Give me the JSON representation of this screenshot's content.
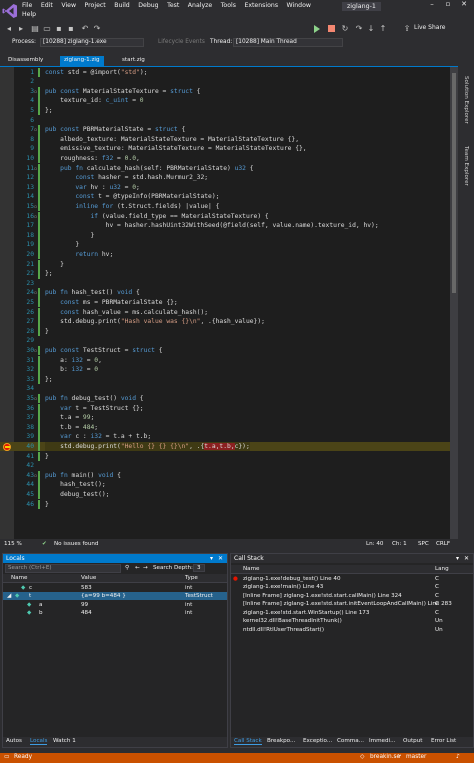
{
  "menu": {
    "items": [
      "File",
      "Edit",
      "View",
      "Project",
      "Build",
      "Debug",
      "Test",
      "Analyze",
      "Tools",
      "Extensions",
      "Window",
      "Help"
    ],
    "project_title": "ziglang-1"
  },
  "toolbar": {
    "live_share": "Live Share"
  },
  "process_bar": {
    "process_label": "Process:",
    "process_value": "[10288] ziglang-1.exe",
    "lifecycle_label": "Lifecycle Events",
    "thread_label": "Thread:",
    "thread_value": "[10288] Main Thread"
  },
  "tabs": {
    "disassembly": "Disassembly",
    "file1": "ziglang-1.zig",
    "file2": "start.zig"
  },
  "editor": {
    "lines": [
      {
        "n": "1",
        "code": "const std = @import(\"std\");"
      },
      {
        "n": "2",
        "code": ""
      },
      {
        "n": "3",
        "code": "pub const MaterialStateTexture = struct {"
      },
      {
        "n": "4",
        "code": "    texture_id: c_uint = 0"
      },
      {
        "n": "5",
        "code": "};"
      },
      {
        "n": "6",
        "code": ""
      },
      {
        "n": "7",
        "code": "pub const PBRMaterialState = struct {"
      },
      {
        "n": "8",
        "code": "    albedo_texture: MaterialStateTexture = MaterialStateTexture {},"
      },
      {
        "n": "9",
        "code": "    emissive_texture: MaterialStateTexture = MaterialStateTexture {},"
      },
      {
        "n": "10",
        "code": "    roughness: f32 = 0.0,"
      },
      {
        "n": "11",
        "code": "    pub fn calculate_hash(self: PBRMaterialState) u32 {"
      },
      {
        "n": "12",
        "code": "        const hasher = std.hash.Murmur2_32;"
      },
      {
        "n": "13",
        "code": "        var hv : u32 = 0;"
      },
      {
        "n": "14",
        "code": "        const t = @typeInfo(PBRMaterialState);"
      },
      {
        "n": "15",
        "code": "        inline for (t.Struct.fields) |value| {"
      },
      {
        "n": "16",
        "code": "            if (value.field_type == MaterialStateTexture) {"
      },
      {
        "n": "17",
        "code": "                hv = hasher.hashUint32WithSeed(@field(self, value.name).texture_id, hv);"
      },
      {
        "n": "18",
        "code": "            }"
      },
      {
        "n": "19",
        "code": "        }"
      },
      {
        "n": "20",
        "code": "        return hv;"
      },
      {
        "n": "21",
        "code": "    }"
      },
      {
        "n": "22",
        "code": "};"
      },
      {
        "n": "23",
        "code": ""
      },
      {
        "n": "24",
        "code": "pub fn hash_test() void {"
      },
      {
        "n": "25",
        "code": "    const ms = PBRMaterialState {};"
      },
      {
        "n": "26",
        "code": "    const hash_value = ms.calculate_hash();"
      },
      {
        "n": "27",
        "code": "    std.debug.print(\"Hash value was {}\\n\", .{hash_value});"
      },
      {
        "n": "28",
        "code": "}"
      },
      {
        "n": "29",
        "code": ""
      },
      {
        "n": "30",
        "code": "pub const TestStruct = struct {"
      },
      {
        "n": "31",
        "code": "    a: i32 = 0,"
      },
      {
        "n": "32",
        "code": "    b: i32 = 0"
      },
      {
        "n": "33",
        "code": "};"
      },
      {
        "n": "34",
        "code": ""
      },
      {
        "n": "35",
        "code": "pub fn debug_test() void {"
      },
      {
        "n": "36",
        "code": "    var t = TestStruct {};"
      },
      {
        "n": "37",
        "code": "    t.a = 99;"
      },
      {
        "n": "38",
        "code": "    t.b = 484;"
      },
      {
        "n": "39",
        "code": "    var c : i32 = t.a + t.b;"
      },
      {
        "n": "40",
        "code": "    std.debug.print(\"Hello {} {} {}\\n\", .{t.a,t.b,c});"
      },
      {
        "n": "41",
        "code": "}"
      },
      {
        "n": "42",
        "code": ""
      },
      {
        "n": "43",
        "code": "pub fn main() void {"
      },
      {
        "n": "44",
        "code": "    hash_test();"
      },
      {
        "n": "45",
        "code": "    debug_test();"
      },
      {
        "n": "46",
        "code": "}"
      }
    ]
  },
  "editor_status": {
    "zoom": "115 %",
    "issues": "No issues found",
    "ln": "Ln: 40",
    "ch": "Ch: 1",
    "spc": "SPC",
    "crlf": "CRLF"
  },
  "side_tabs": {
    "solution_explorer": "Solution Explorer",
    "team_explorer": "Team Explorer"
  },
  "locals": {
    "title": "Locals",
    "search_placeholder": "Search (Ctrl+E)",
    "search_depth_label": "Search Depth:",
    "search_depth_value": "3",
    "columns": [
      "Name",
      "Value",
      "Type"
    ],
    "rows": [
      {
        "name": "c",
        "value": "583",
        "type": "int"
      },
      {
        "name": "t",
        "value": "{a=99 b=484 }",
        "type": "TestStruct"
      },
      {
        "name": "a",
        "value": "99",
        "type": "int"
      },
      {
        "name": "b",
        "value": "484",
        "type": "int"
      }
    ],
    "bottom_tabs": [
      "Autos",
      "Locals",
      "Watch 1"
    ]
  },
  "callstack": {
    "title": "Call Stack",
    "columns": [
      "Name",
      "Lang"
    ],
    "rows": [
      {
        "name": "ziglang-1.exe!debug_test() Line 40",
        "lang": "C"
      },
      {
        "name": "ziglang-1.exe!main() Line 43",
        "lang": "C"
      },
      {
        "name": "[Inline Frame] ziglang-1.exe!std.start.callMain() Line 324",
        "lang": "C"
      },
      {
        "name": "[Inline Frame] ziglang-1.exe!std.start.initEventLoopAndCallMain() Line 283",
        "lang": "C"
      },
      {
        "name": "ziglang-1.exe!std.start.WinStartup() Line 173",
        "lang": "C"
      },
      {
        "name": "kernel32.dll!BaseThreadInitThunk()",
        "lang": "Un"
      },
      {
        "name": "ntdll.dll!RtlUserThreadStart()",
        "lang": "Un"
      }
    ],
    "bottom_tabs": [
      "Call Stack",
      "Breakpo...",
      "Exceptio...",
      "Comma...",
      "Immedi...",
      "Output",
      "Error List"
    ]
  },
  "statusbar": {
    "ready": "Ready",
    "branch_repo": "breakin.se",
    "branch": "master"
  },
  "colors": {
    "accent": "#007acc",
    "status": "#ca5100",
    "editor_bg": "#1e1e1e"
  }
}
